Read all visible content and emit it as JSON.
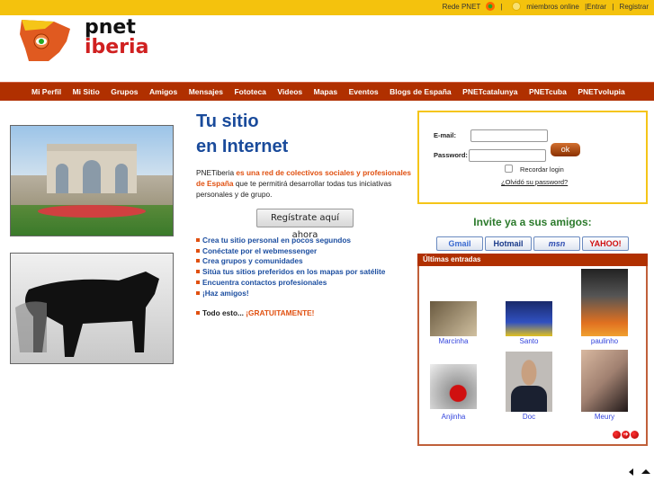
{
  "topbar": {
    "rede": "Rede PNET",
    "sep1": "|",
    "members": "miembros online",
    "enter": "|Entrar",
    "sep2": "|",
    "register": "Registrar"
  },
  "logo": {
    "line1": "pnet",
    "line2": "iberia"
  },
  "nav": [
    "Mi Perfil",
    "Mi Sitio",
    "Grupos",
    "Amigos",
    "Mensajes",
    "Fototeca",
    "Videos",
    "Mapas",
    "Eventos",
    "Blogs de España",
    "PNETcatalunya",
    "PNETcuba",
    "PNETvolupia"
  ],
  "hero": {
    "title1": "Tu sitio",
    "title2": "en Internet",
    "p_start": "PNETiberia ",
    "p_hl": "es una red de colectivos sociales y profesionales de España",
    "p_end": " que te permitirá desarrollar todas tus iniciativas personales y de grupo.",
    "register_button": "Regístrate aquí ahora",
    "features": [
      "Crea tu sitio personal en pocos segundos",
      "Conéctate por el webmessenger",
      "Crea grupos y comunidades",
      "Sitúa tus sitios preferidos en los mapas por satélite",
      "Encuentra contactos profesionales",
      "¡Haz amigos!"
    ],
    "free_pre": "Todo esto... ",
    "free_hl": "¡GRATUITAMENTE!"
  },
  "login": {
    "email_label": "E-mail:",
    "password_label": "Password:",
    "email_value": "",
    "password_value": "",
    "ok": "ok",
    "remember": "Recordar login",
    "forgot": "¿Olvidó su password?"
  },
  "invite": {
    "title": "Invite ya a sus amigos:",
    "providers": [
      "Gmail",
      "Hotmail",
      "msn",
      "YAHOO!"
    ]
  },
  "latest": {
    "title": "Últimas entradas",
    "users": [
      "Marcinha",
      "Santo",
      "paulinho",
      "Anjinha",
      "Doc",
      "Meury"
    ]
  }
}
